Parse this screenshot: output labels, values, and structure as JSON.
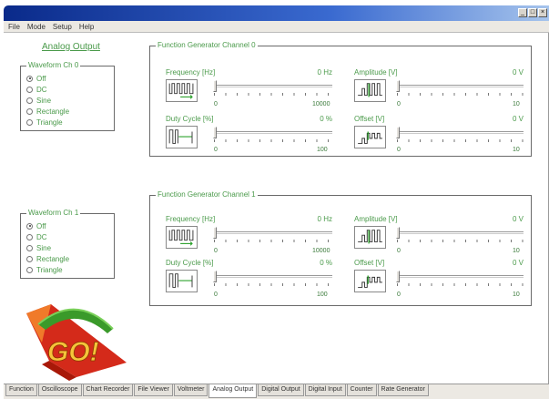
{
  "window": {
    "minimize": "_",
    "maximize": "□",
    "close": "×"
  },
  "menu": [
    "File",
    "Mode",
    "Setup",
    "Help"
  ],
  "section_title": "Analog Output",
  "waveform_options": [
    "Off",
    "DC",
    "Sine",
    "Rectangle",
    "Triangle"
  ],
  "ch0": {
    "waveform_legend": "Waveform Ch 0",
    "waveform_selected": "Off",
    "gen_legend": "Function Generator Channel 0",
    "frequency": {
      "label": "Frequency [Hz]",
      "value": "0 Hz",
      "min": "0",
      "max": "10000"
    },
    "amplitude": {
      "label": "Amplitude [V]",
      "value": "0 V",
      "min": "0",
      "max": "10"
    },
    "duty": {
      "label": "Duty Cycle [%]",
      "value": "0 %",
      "min": "0",
      "max": "100"
    },
    "offset": {
      "label": "Offset [V]",
      "value": "0 V",
      "min": "0",
      "max": "10"
    }
  },
  "ch1": {
    "waveform_legend": "Waveform Ch 1",
    "waveform_selected": "Off",
    "gen_legend": "Function Generator Channel 1",
    "frequency": {
      "label": "Frequency [Hz]",
      "value": "0 Hz",
      "min": "0",
      "max": "10000"
    },
    "amplitude": {
      "label": "Amplitude [V]",
      "value": "0 V",
      "min": "0",
      "max": "10"
    },
    "duty": {
      "label": "Duty Cycle [%]",
      "value": "0 %",
      "min": "0",
      "max": "100"
    },
    "offset": {
      "label": "Offset [V]",
      "value": "0 V",
      "min": "0",
      "max": "10"
    }
  },
  "logo_text": "GO!",
  "tabs": [
    "Function",
    "Oscilloscope",
    "Chart Recorder",
    "File Viewer",
    "Voltmeter",
    "Analog Output",
    "Digital Output",
    "Digital Input",
    "Counter",
    "Rate Generator"
  ],
  "active_tab": "Analog Output",
  "colors": {
    "text_green": "#4a9a4a",
    "titlebar": "#0a2a8a",
    "logo_red": "#d42a1a",
    "logo_green": "#3a9a2a"
  }
}
